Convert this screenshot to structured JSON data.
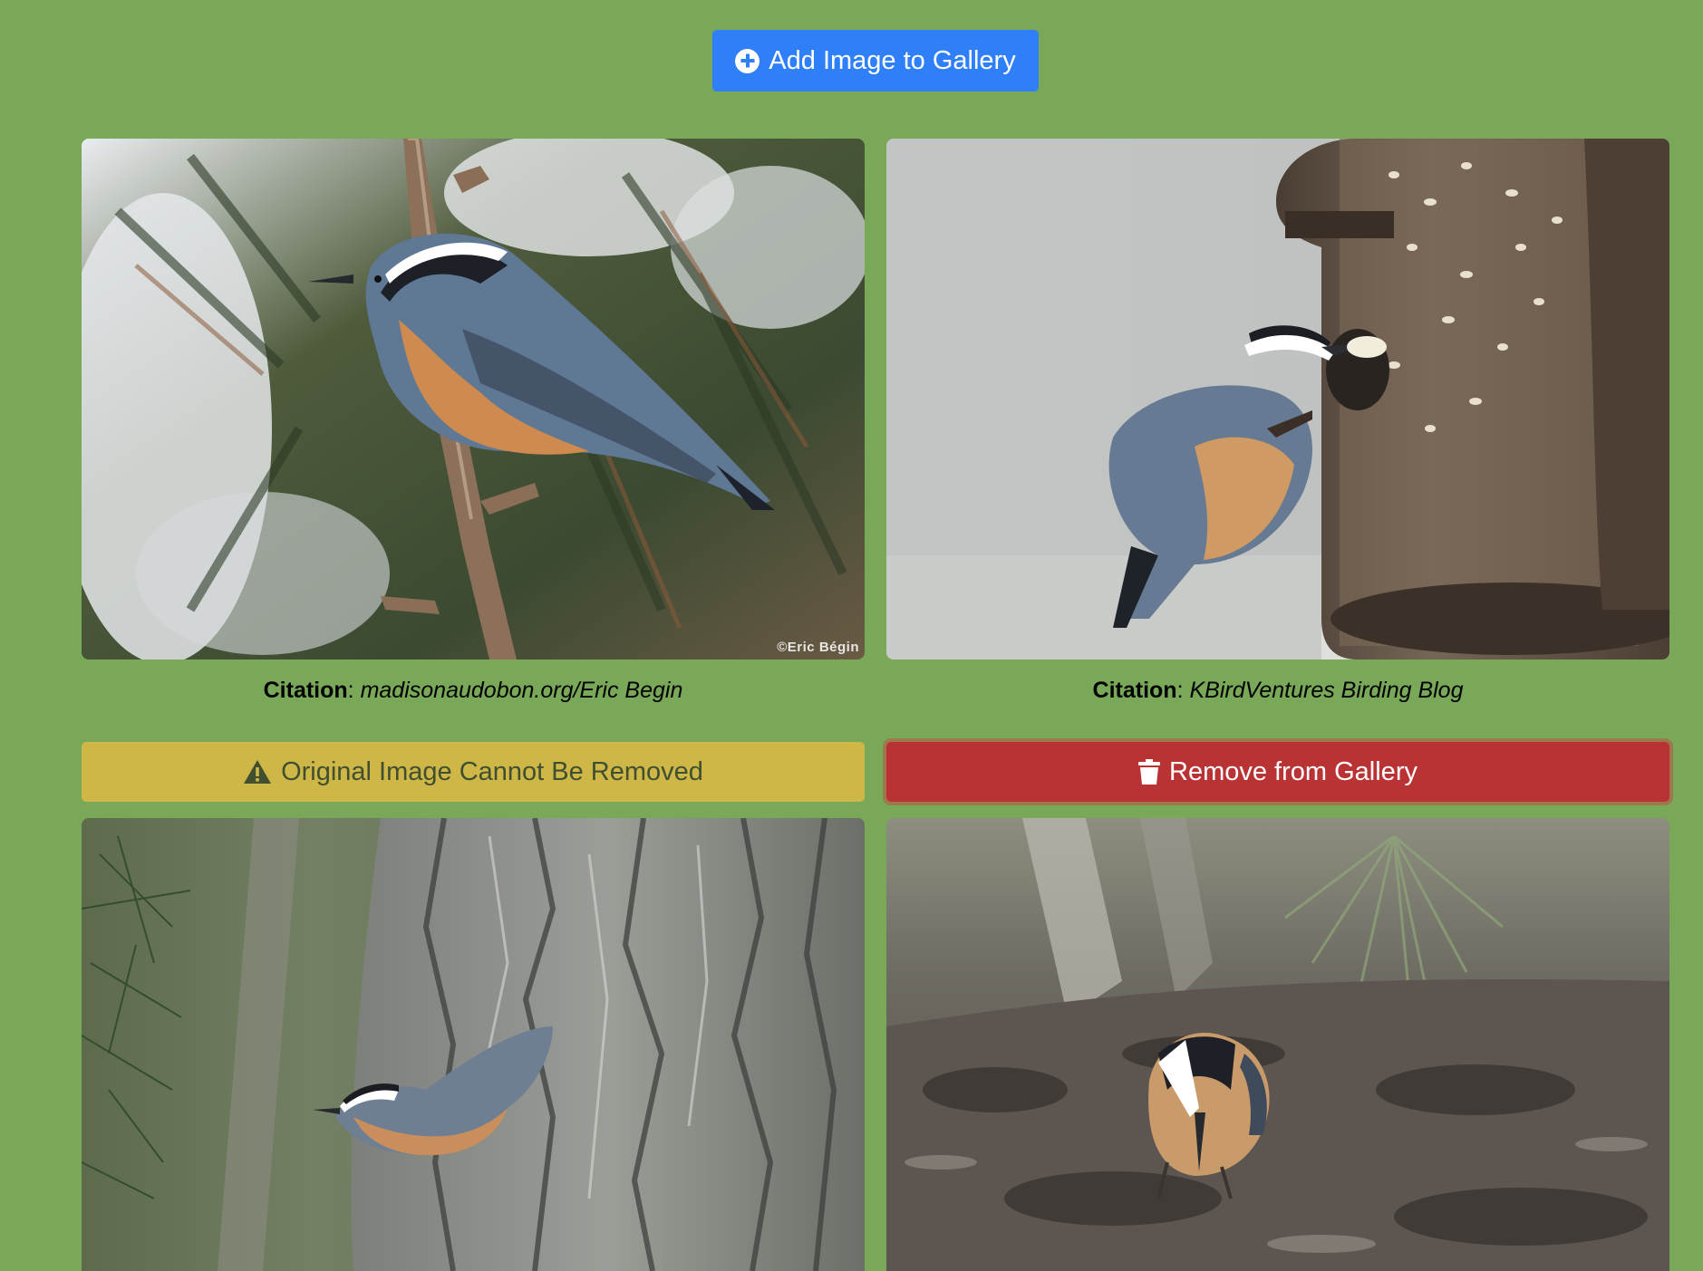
{
  "toolbar": {
    "add_label": "Add Image to Gallery"
  },
  "gallery": {
    "items": [
      {
        "image_alt": "Red-breasted nuthatch perched on a spruce branch",
        "watermark": "©Eric Bégin",
        "citation_label": "Citation",
        "citation_separator": ":",
        "citation_source": "madisonaudobon.org/Eric Begin",
        "action_label": "Original Image Cannot Be Removed",
        "action_type": "warning"
      },
      {
        "image_alt": "Red-breasted nuthatch feeding at a seed feeder",
        "citation_label": "Citation",
        "citation_separator": ":",
        "citation_source": "KBirdVentures Birding Blog",
        "action_label": "Remove from Gallery",
        "action_type": "danger"
      },
      {
        "image_alt": "Red-breasted nuthatch on a pine tree trunk"
      },
      {
        "image_alt": "Red-breasted nuthatch foraging on the ground"
      }
    ]
  },
  "colors": {
    "background": "#79a858",
    "primary": "#2f7ff8",
    "warning": "#cfb747",
    "danger": "#b93335"
  },
  "icons": {
    "add": "plus-circle-icon",
    "warning": "warning-triangle-icon",
    "remove": "trash-icon"
  }
}
